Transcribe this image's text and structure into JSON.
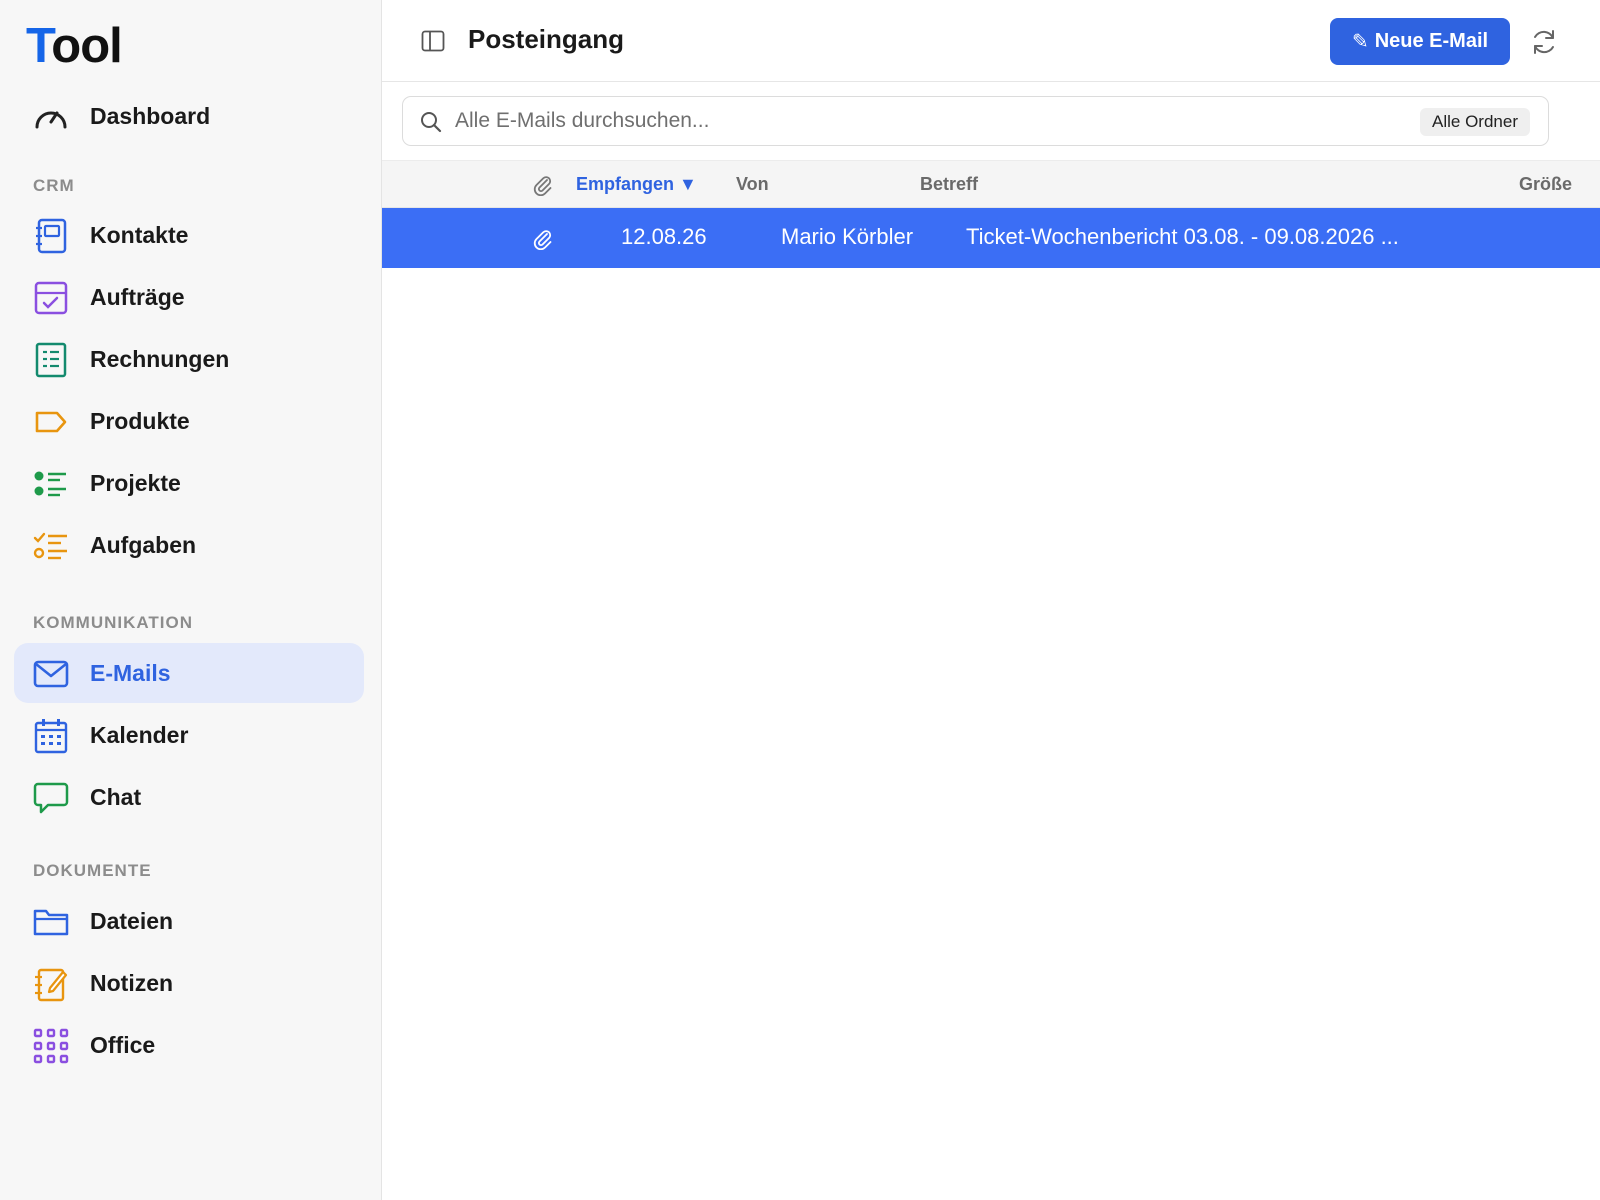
{
  "app": {
    "logo_first": "T",
    "logo_rest": "ool"
  },
  "sidebar": {
    "dashboard": "Dashboard",
    "sections": {
      "crm": "CRM",
      "kommunikation": "KOMMUNIKATION",
      "dokumente": "DOKUMENTE"
    },
    "items": [
      {
        "label": "Kontakte",
        "icon": "contacts-icon"
      },
      {
        "label": "Aufträge",
        "icon": "orders-icon"
      },
      {
        "label": "Rechnungen",
        "icon": "invoice-icon"
      },
      {
        "label": "Produkte",
        "icon": "tag-icon"
      },
      {
        "label": "Projekte",
        "icon": "projects-list-icon"
      },
      {
        "label": "Aufgaben",
        "icon": "tasks-icon"
      },
      {
        "label": "E-Mails",
        "icon": "mail-icon",
        "active": true
      },
      {
        "label": "Kalender",
        "icon": "calendar-icon"
      },
      {
        "label": "Chat",
        "icon": "chat-bubble-icon"
      },
      {
        "label": "Dateien",
        "icon": "folder-icon"
      },
      {
        "label": "Notizen",
        "icon": "notes-icon"
      },
      {
        "label": "Office",
        "icon": "apps-grid-icon"
      }
    ]
  },
  "header": {
    "title": "Posteingang",
    "new_mail_label": "Neue E-Mail",
    "new_mail_glyph": "✎"
  },
  "search": {
    "placeholder": "Alle E-Mails durchsuchen...",
    "scope": "Alle Ordner"
  },
  "table": {
    "columns": {
      "received": "Empfangen",
      "sort_indicator": "▼",
      "from": "Von",
      "subject": "Betreff",
      "size": "Größe"
    },
    "rows": [
      {
        "has_attachment": true,
        "received": "12.08.26",
        "from": "Mario Körbler",
        "subject": "Ticket-Wochenbericht 03.08. - 09.08.2026 ...",
        "size": "",
        "selected": true
      }
    ]
  },
  "colors": {
    "accent": "#2f63e0",
    "selected_row": "#3b6ef5",
    "active_nav_bg": "#e3e9fb"
  }
}
